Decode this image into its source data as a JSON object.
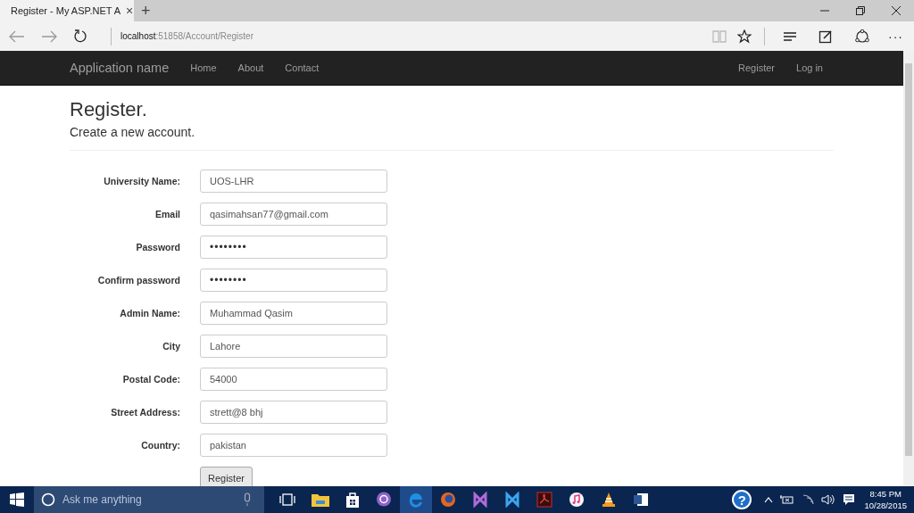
{
  "browser": {
    "tab_title": "Register - My ASP.NET A",
    "tab_close": "×",
    "new_tab": "+",
    "address_host": "localhost",
    "address_rest": ":51858/Account/Register",
    "more": "···"
  },
  "navbar": {
    "brand": "Application name",
    "links": [
      "Home",
      "About",
      "Contact"
    ],
    "right_links": [
      "Register",
      "Log in"
    ]
  },
  "page": {
    "title": "Register.",
    "subtitle": "Create a new account."
  },
  "form": {
    "fields": [
      {
        "label": "University Name:",
        "value": "UOS-LHR",
        "kind": "text"
      },
      {
        "label": "Email",
        "value": "qasimahsan77@gmail.com",
        "kind": "text"
      },
      {
        "label": "Password",
        "value": "••••••••",
        "kind": "password"
      },
      {
        "label": "Confirm password",
        "value": "••••••••",
        "kind": "password"
      },
      {
        "label": "Admin Name:",
        "value": "Muhammad Qasim",
        "kind": "text"
      },
      {
        "label": "City",
        "value": "Lahore",
        "kind": "text"
      },
      {
        "label": "Postal Code:",
        "value": "54000",
        "kind": "text"
      },
      {
        "label": "Street Address:",
        "value": "strett@8 bhj",
        "kind": "text"
      },
      {
        "label": "Country:",
        "value": "pakistan",
        "kind": "text"
      }
    ],
    "submit": "Register"
  },
  "taskbar": {
    "search_placeholder": "Ask me anything",
    "help": "?",
    "time": "8:45 PM",
    "date": "10/28/2015"
  }
}
